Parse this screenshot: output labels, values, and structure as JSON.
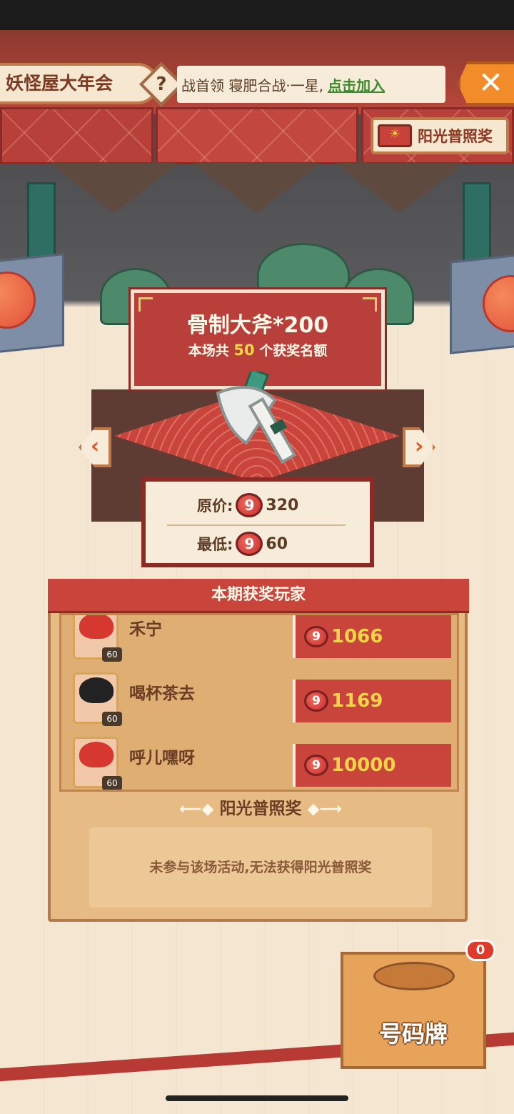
{
  "top_bar": {
    "title": "妖怪屋大年会",
    "help_glyph": "?",
    "marquee_text": "战首领 寝肥合战·一星,",
    "marquee_link": "点击加入",
    "close_glyph": "✕"
  },
  "sunshine_button": {
    "label": "阳光普照奖"
  },
  "prize": {
    "name": "骨制大斧*200",
    "subtitle_pre": "本场共",
    "count": "50",
    "subtitle_post": "个获奖名额",
    "item_icon": "bone-axe-icon"
  },
  "nav": {
    "prev_glyph": "‹",
    "next_glyph": "›"
  },
  "price": {
    "original_label": "原价:",
    "original_value": "320",
    "min_label": "最低:",
    "min_value": "60",
    "coin_glyph": "9"
  },
  "winners": {
    "title": "本期获奖玩家",
    "rows": [
      {
        "name": "禾宁",
        "level": "60",
        "bid": "1066"
      },
      {
        "name": "喝杯茶去",
        "level": "60",
        "bid": "1169"
      },
      {
        "name": "呼儿嘿呀",
        "level": "60",
        "bid": "10000"
      }
    ]
  },
  "sunshine_section": {
    "title": "阳光普照奖",
    "message": "未参与该场活动,无法获得阳光普照奖"
  },
  "ticket": {
    "label": "号码牌",
    "badge": "0"
  },
  "colors": {
    "accent_red": "#c9453c",
    "gold": "#f7d24a",
    "panel": "#e7bb84",
    "link_green": "#3e8a2f"
  }
}
